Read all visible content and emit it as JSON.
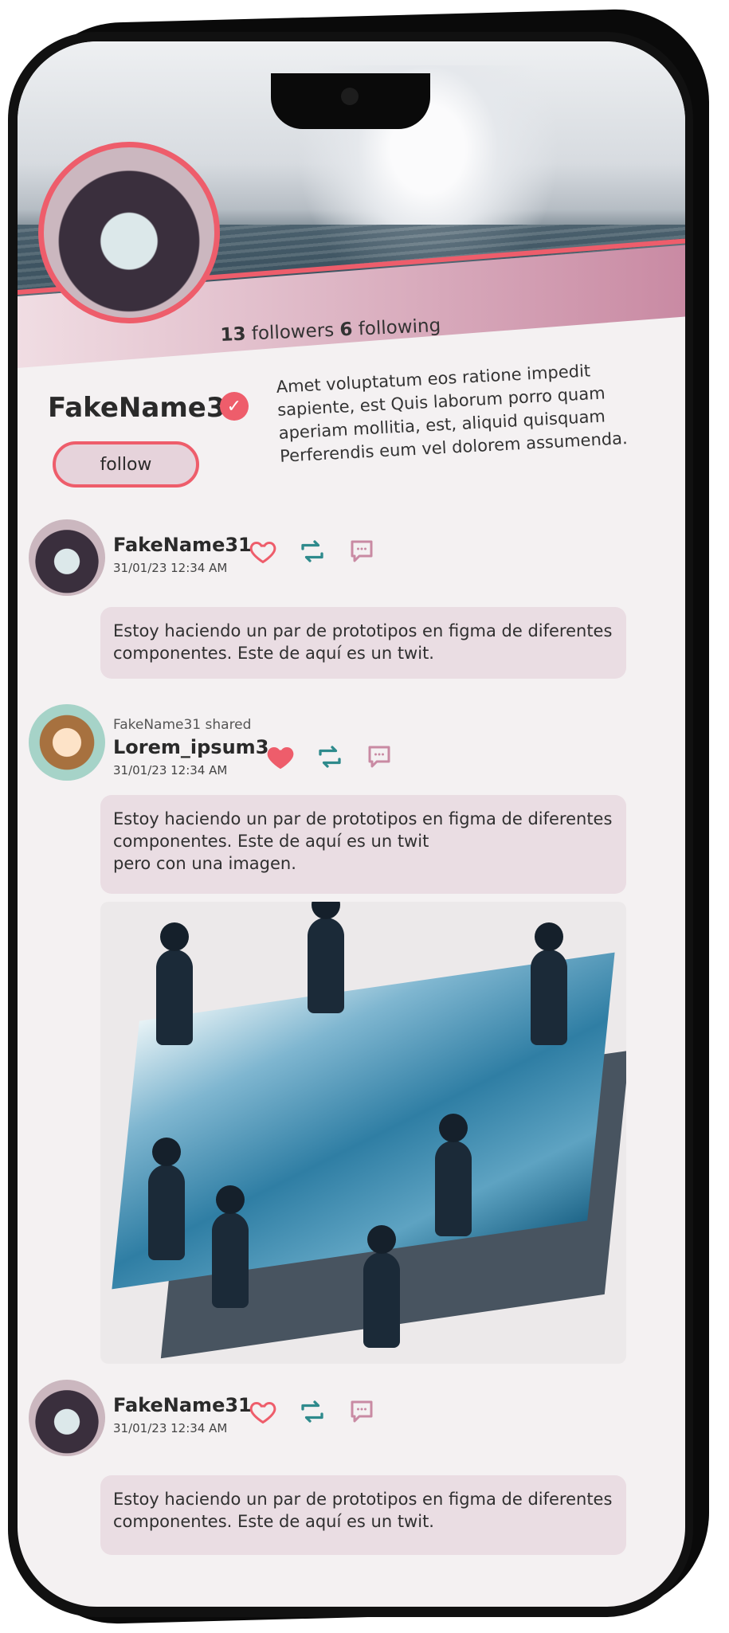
{
  "profile": {
    "followers_count": "13",
    "followers_label": "followers",
    "following_count": "6",
    "following_label": "following",
    "username": "FakeName31",
    "verified_icon": "verified-check-icon",
    "bio": "Amet voluptatum eos ratione impedit sapiente, est Quis laborum porro quam aperiam mollitia, est, aliquid quisquam Perferendis eum vel dolorem assumenda.",
    "follow_label": "follow"
  },
  "posts": [
    {
      "author": "FakeName31",
      "date": "31/01/23 12:34 AM",
      "liked": false,
      "text": "Estoy haciendo un par de prototipos en figma de diferentes componentes. Este de aquí es un twit."
    },
    {
      "shared_by": "FakeName31 shared",
      "author": "Lorem_ipsum3",
      "date": "31/01/23 12:34 AM",
      "liked": true,
      "text_line1": "Estoy haciendo un par de prototipos en figma de diferentes componentes. Este de aquí es un twit",
      "text_line2": "pero con una imagen."
    },
    {
      "author": "FakeName31",
      "date": "31/01/23 12:34 AM",
      "liked": false,
      "text": "Estoy haciendo un par de prototipos en figma de diferentes componentes. Este de aquí es un twit."
    }
  ],
  "colors": {
    "accent": "#ee5d6b",
    "retweet": "#2e8a8c",
    "comment": "#c98aa3",
    "bubble": "#eadde3",
    "background": "#f4f1f2"
  }
}
